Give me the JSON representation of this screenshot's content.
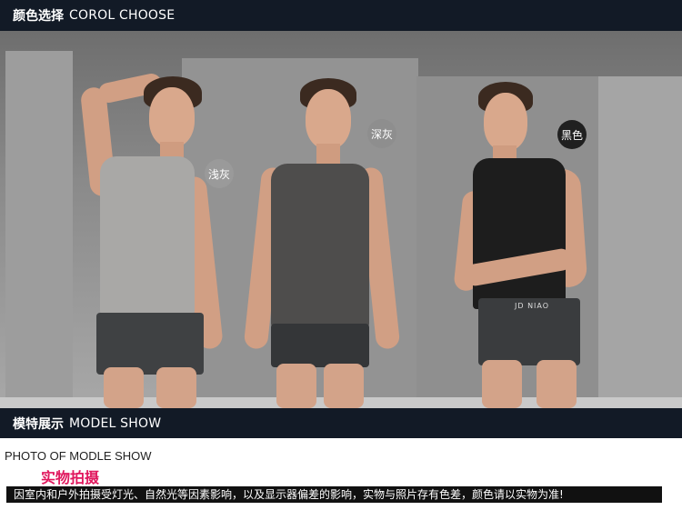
{
  "header": {
    "cn": "颜色选择",
    "en": "COROL CHOOSE"
  },
  "photo": {
    "models": [
      {
        "color_label": "浅灰",
        "vest_color": "#a9a8a6",
        "brief_color": "#3f4143",
        "badge_color": "#9a9a9a"
      },
      {
        "color_label": "深灰",
        "vest_color": "#4e4d4c",
        "brief_color": "#343638",
        "badge_color": "#8e8e8e"
      },
      {
        "color_label": "黑色",
        "vest_color": "#1d1d1d",
        "brief_color": "#3a3c3e",
        "badge_color": "#202020"
      }
    ],
    "brand_text": "JD NIAO"
  },
  "section": {
    "cn": "模特展示",
    "en": "MODEL SHOW"
  },
  "caption": {
    "en": "PHOTO OF MODLE SHOW",
    "cn": "实物拍摄"
  },
  "notice": "因室内和户外拍摄受灯光、自然光等因素影响，以及显示器偏差的影响，实物与照片存有色差，颜色请以实物为准!"
}
